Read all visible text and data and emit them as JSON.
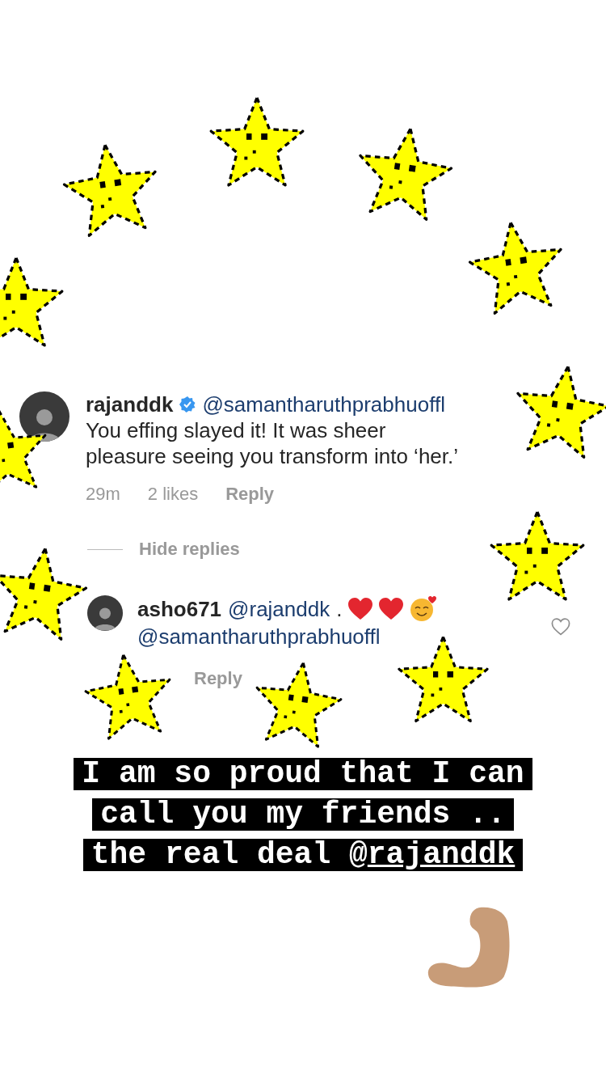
{
  "comment": {
    "username": "rajanddk",
    "verified": true,
    "mention": "@samantharuthprabhuoffl",
    "text": "You effing slayed it! It was sheer pleasure seeing you transform into ‘her.’",
    "meta": [
      "29m",
      "2 likes",
      "Reply"
    ]
  },
  "hide_replies": "Hide replies",
  "reply": {
    "username": "asho671",
    "mention": "@rajanddk",
    "text": ".",
    "emojis": [
      {
        "kind": "heart"
      },
      {
        "kind": "heart"
      },
      {
        "kind": "smiling-hearts"
      }
    ],
    "mention_2": "@samantharuthprabhuoffl",
    "liked": false,
    "meta": [
      "Reply"
    ]
  },
  "caption": [
    {
      "text": "I am so proud that I can"
    },
    {
      "text": "call you my friends .."
    },
    {
      "text": "the real deal @",
      "mention": "rajanddk"
    }
  ],
  "stickers": [
    {
      "kind": "star"
    },
    {
      "kind": "star"
    },
    {
      "kind": "star"
    },
    {
      "kind": "star"
    },
    {
      "kind": "star"
    },
    {
      "kind": "star"
    },
    {
      "kind": "star"
    },
    {
      "kind": "star"
    },
    {
      "kind": "star"
    },
    {
      "kind": "star"
    },
    {
      "kind": "star"
    },
    {
      "kind": "star"
    },
    {
      "kind": "biceps"
    }
  ]
}
